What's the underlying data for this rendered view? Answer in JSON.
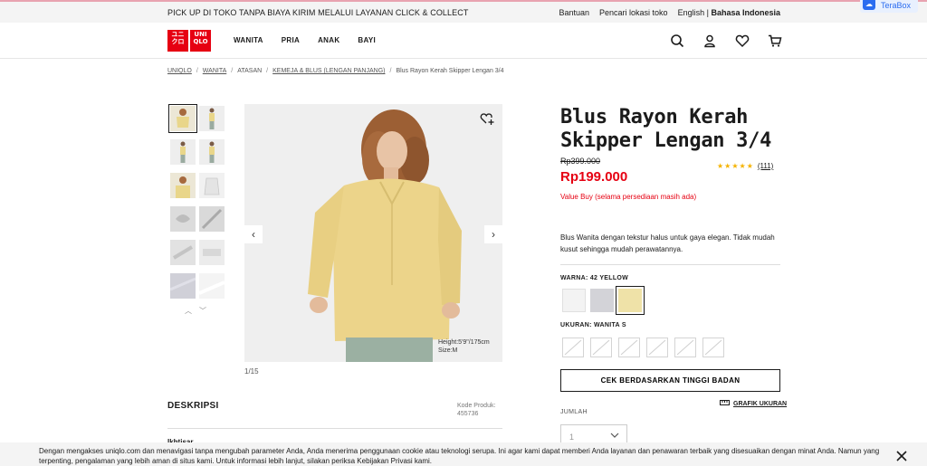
{
  "topbar": {
    "promo": "PICK UP DI TOKO TANPA BIAYA KIRIM MELALUI LAYANAN CLICK & COLLECT",
    "help": "Bantuan",
    "store_locator": "Pencari lokasi toko",
    "lang_en": "English",
    "lang_sep": "|",
    "lang_id": "Bahasa Indonesia",
    "terabox": "TeraBox"
  },
  "header": {
    "logo_left": "ユニ\nクロ",
    "logo_right": "UNI\nQLO",
    "nav": [
      "WANITA",
      "PRIA",
      "ANAK",
      "BAYI"
    ],
    "icons": [
      "search-icon",
      "account-icon",
      "wishlist-icon",
      "cart-icon"
    ]
  },
  "breadcrumb": [
    "UNIQLO",
    "WANITA",
    "ATASAN",
    "KEMEJA & BLUS (LENGAN PANJANG)",
    "Blus Rayon Kerah Skipper Lengan 3/4"
  ],
  "gallery": {
    "caption_height": "Height:5'9\"/175cm",
    "caption_size": "Size:M",
    "counter": "1/15"
  },
  "description": {
    "title": "DESKRIPSI",
    "code_label": "Kode Produk:",
    "code": "455736",
    "overview": "Ikhtisar"
  },
  "product": {
    "title": "Blus Rayon Kerah Skipper Lengan 3/4",
    "old_price": "Rp399.000",
    "price": "Rp199.000",
    "value_buy": "Value Buy (selama persediaan masih ada)",
    "rating_stars": "★★★★★",
    "rating_value": 4.5,
    "review_count": "(111)",
    "text": "Blus Wanita dengan tekstur halus untuk gaya elegan. Tidak mudah kusut sehingga mudah perawatannya.",
    "color_label": "WARNA: 42 YELLOW",
    "colors": [
      "#f3f3f3",
      "#d3d3d8",
      "#efe2a8"
    ],
    "size_label": "UKURAN: WANITA S",
    "size_cta": "CEK BERDASARKAN TINGGI BADAN",
    "size_guide": "GRAFIK UKURAN",
    "qty_label": "JUMLAH",
    "qty_value": "1"
  },
  "cookie": {
    "text": "Dengan mengakses uniqlo.com dan menavigasi tanpa mengubah parameter Anda, Anda menerima penggunaan cookie atau teknologi serupa. Ini agar kami dapat memberi Anda layanan dan penawaran terbaik yang disesuaikan dengan minat Anda. Namun yang terpenting, pengalaman yang lebih aman di situs kami. Untuk informasi lebih lanjut, silakan periksa Kebijakan Privasi kami."
  }
}
